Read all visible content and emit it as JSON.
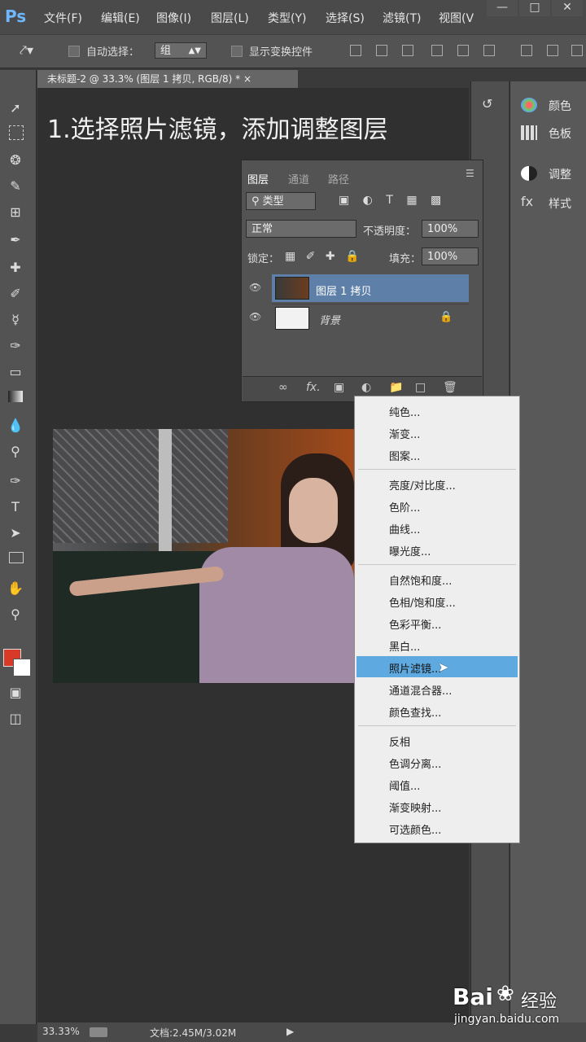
{
  "menubar": {
    "logo": "Ps",
    "items": [
      "文件(F)",
      "编辑(E)",
      "图像(I)",
      "图层(L)",
      "类型(Y)",
      "选择(S)",
      "滤镜(T)",
      "视图(V"
    ]
  },
  "options": {
    "auto_select_label": "自动选择：",
    "auto_select_value": "组",
    "show_transform_label": "显示变换控件"
  },
  "doc_tab": {
    "title": "未标题-2 @ 33.3% (图层 1 拷贝, RGB/8) * ",
    "close": "×"
  },
  "overlay_title": "1.选择照片滤镜，添加调整图层",
  "layers_panel": {
    "tabs": [
      "图层",
      "通道",
      "路径"
    ],
    "filter_label": "类型",
    "blend_mode": "正常",
    "opacity_label": "不透明度：",
    "opacity_value": "100%",
    "lock_label": "锁定：",
    "fill_label": "填充：",
    "fill_value": "100%",
    "layers": [
      {
        "name": "图层 1 拷贝"
      },
      {
        "name": "背景"
      }
    ]
  },
  "context_menu": {
    "group1": [
      "纯色...",
      "渐变...",
      "图案..."
    ],
    "group2": [
      "亮度/对比度...",
      "色阶...",
      "曲线...",
      "曝光度..."
    ],
    "group3": [
      "自然饱和度...",
      "色相/饱和度...",
      "色彩平衡...",
      "黑白...",
      "照片滤镜...",
      "通道混合器...",
      "颜色查找..."
    ],
    "group4": [
      "反相",
      "色调分离...",
      "阈值...",
      "渐变映射...",
      "可选颜色..."
    ]
  },
  "dock": {
    "items": [
      "颜色",
      "色板",
      "调整",
      "样式"
    ]
  },
  "status": {
    "zoom": "33.33%",
    "doc_info": "文档:2.45M/3.02M"
  },
  "watermark": {
    "brand": "Bai",
    "brand2": "经验",
    "url": "jingyan.baidu.com"
  }
}
